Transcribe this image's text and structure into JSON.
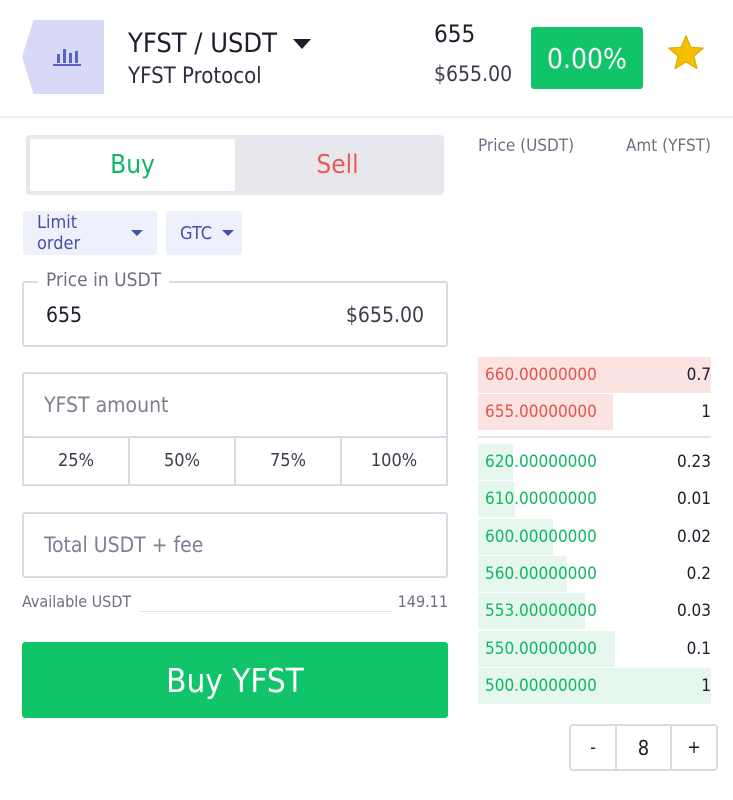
{
  "header": {
    "pair": "YFST / USDT",
    "project": "YFST Protocol",
    "price": "655",
    "price_usd": "$655.00",
    "change": "0.00%",
    "icons": {
      "logo": "bar-chart-icon",
      "favorite": "star-icon",
      "pair_caret": "caret-down-icon"
    },
    "colors": {
      "accent": "#11c46a",
      "logo_bg": "#d7d9f6",
      "star": "#f5c000"
    }
  },
  "tabs": {
    "buy": "Buy",
    "sell": "Sell",
    "active": "Buy"
  },
  "order_type": {
    "selected": "Limit order"
  },
  "time_in_force": {
    "selected": "GTC"
  },
  "price_field": {
    "label": "Price in USDT",
    "value": "655",
    "usd_value": "$655.00"
  },
  "amount_field": {
    "placeholder": "YFST amount",
    "value": ""
  },
  "percent_buttons": [
    "25%",
    "50%",
    "75%",
    "100%"
  ],
  "total_field": {
    "placeholder": "Total USDT + fee",
    "value": ""
  },
  "available": {
    "label": "Available USDT",
    "value": "149.11"
  },
  "submit": {
    "label": "Buy YFST"
  },
  "orderbook": {
    "header_price": "Price (USDT)",
    "header_amount": "Amt (YFST)",
    "asks": [
      {
        "price": "660.00000000",
        "amount": "0.7",
        "depth": 1.0
      },
      {
        "price": "655.00000000",
        "amount": "1",
        "depth": 0.58
      }
    ],
    "bids": [
      {
        "price": "620.00000000",
        "amount": "0.23",
        "depth": 0.15
      },
      {
        "price": "610.00000000",
        "amount": "0.01",
        "depth": 0.16
      },
      {
        "price": "600.00000000",
        "amount": "0.02",
        "depth": 0.32
      },
      {
        "price": "560.00000000",
        "amount": "0.2",
        "depth": 0.38
      },
      {
        "price": "553.00000000",
        "amount": "0.03",
        "depth": 0.46
      },
      {
        "price": "550.00000000",
        "amount": "0.1",
        "depth": 0.59
      },
      {
        "price": "500.00000000",
        "amount": "1",
        "depth": 1.0
      }
    ],
    "colors": {
      "ask": "#e4534b",
      "bid": "#11b863"
    }
  },
  "precision_stepper": {
    "minus": "-",
    "value": "8",
    "plus": "+"
  }
}
